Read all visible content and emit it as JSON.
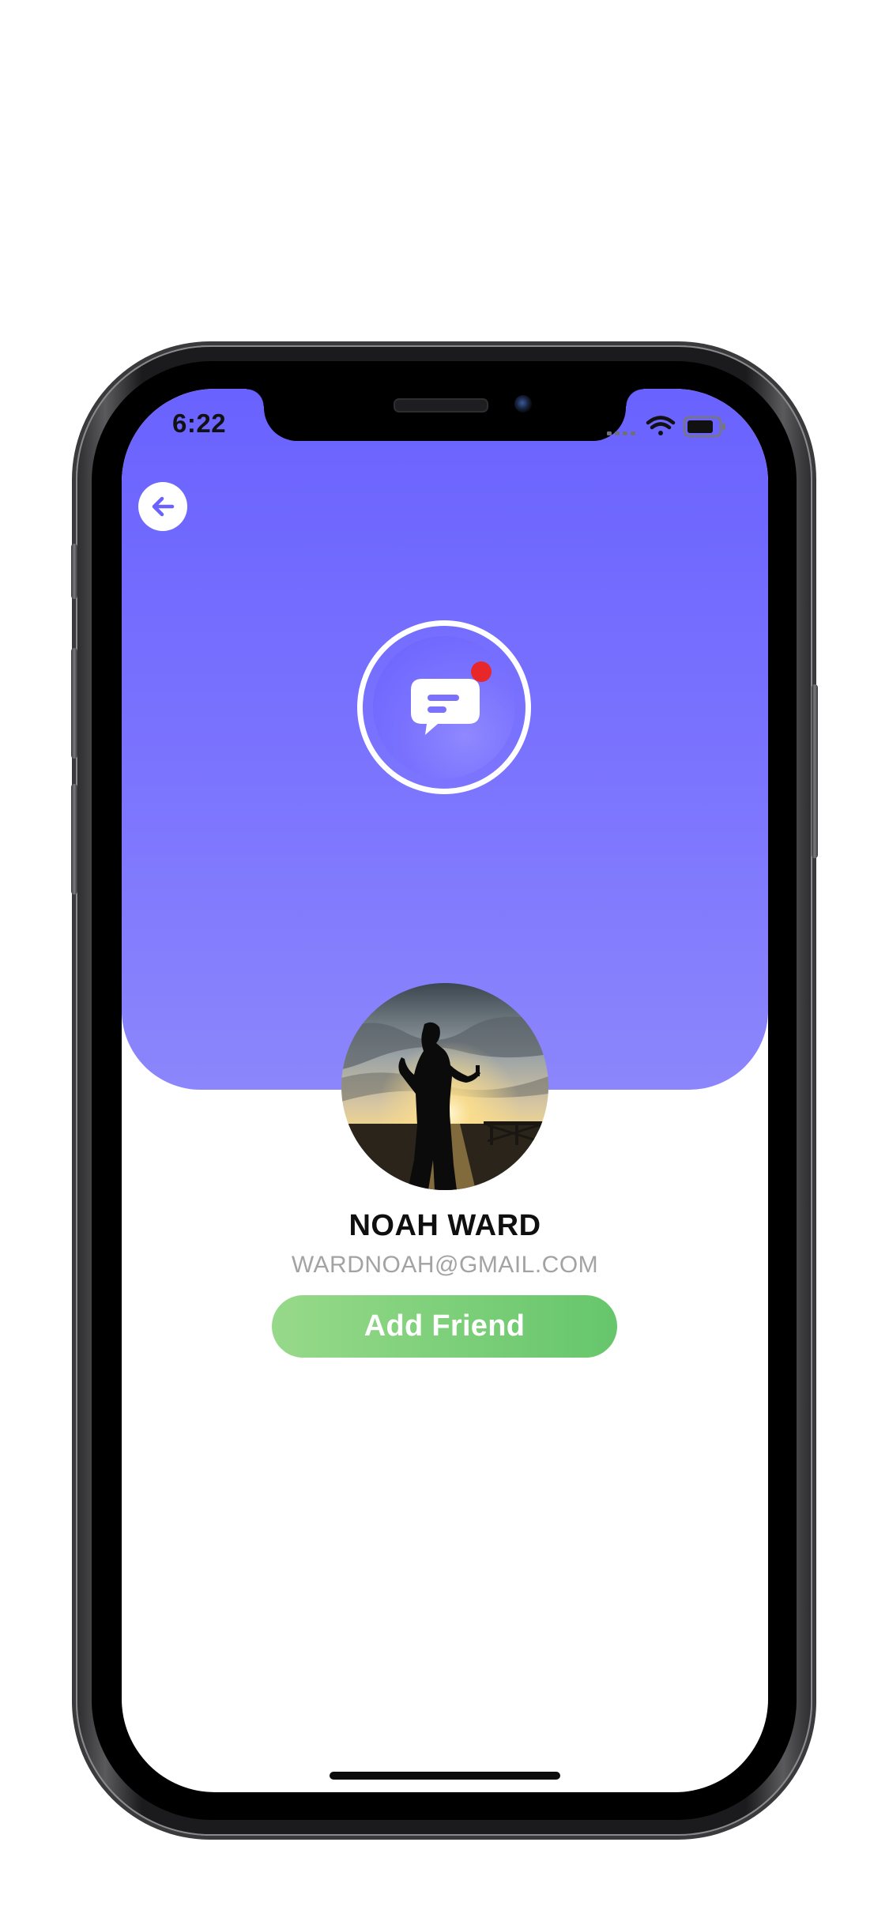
{
  "status_bar": {
    "time": "6:22",
    "icons": [
      "signal-icon",
      "wifi-icon",
      "battery-icon"
    ]
  },
  "header": {
    "background_gradient": [
      "#6a62fe",
      "#8c86fc"
    ],
    "back_icon": "arrow-left-icon",
    "badge_icon": "chat-bubble-icon",
    "notification_dot_color": "#e8272a"
  },
  "profile": {
    "name": "NOAH WARD",
    "email": "WARDNOAH@GMAIL.COM",
    "avatar_description": "silhouette-at-sunset"
  },
  "actions": {
    "add_friend_label": "Add Friend",
    "add_friend_color": "#7ed07a"
  }
}
